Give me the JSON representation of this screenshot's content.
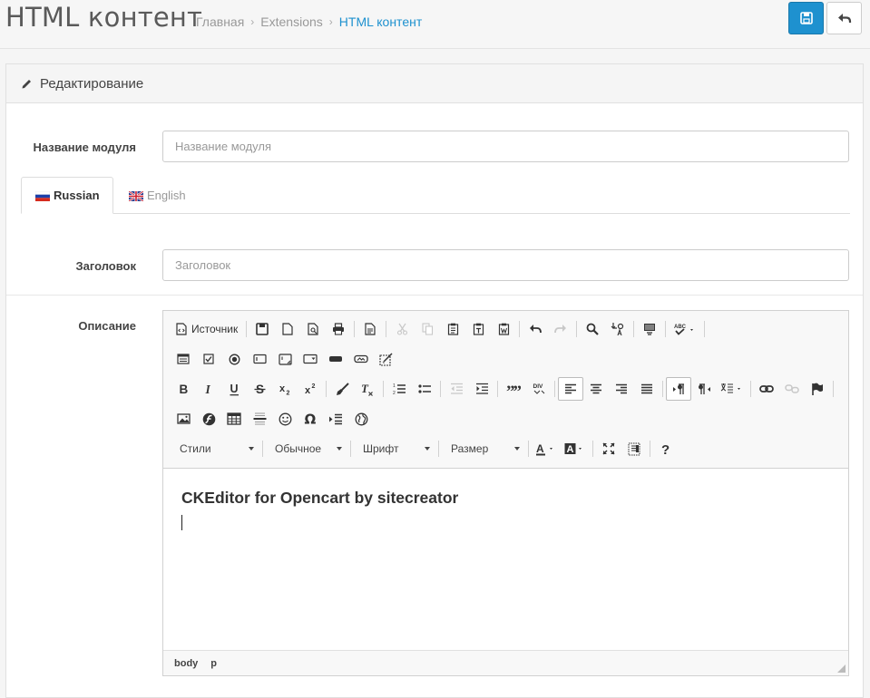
{
  "header": {
    "title": "HTML контент",
    "breadcrumb": [
      "Главная",
      "Extensions",
      "HTML контент"
    ],
    "save_icon": "floppy-disk-icon",
    "back_icon": "reply-arrow-icon",
    "accent_color": "#1e91cf"
  },
  "panel": {
    "heading": "Редактирование",
    "heading_icon": "pencil-icon"
  },
  "form": {
    "module_name_label": "Название модуля",
    "module_name_placeholder": "Название модуля",
    "module_name_value": "",
    "tabs": [
      {
        "label": "Russian",
        "flag": "russian-flag-icon",
        "active": true
      },
      {
        "label": "English",
        "flag": "uk-flag-icon",
        "active": false
      }
    ],
    "title_label": "Заголовок",
    "title_placeholder": "Заголовок",
    "title_value": "",
    "description_label": "Описание"
  },
  "editor": {
    "source_label": "Источник",
    "styles_label": "Стили",
    "format_label": "Обычное",
    "font_label": "Шрифт",
    "size_label": "Размер",
    "content_heading": "CKEditor for Opencart by sitecreator",
    "path": [
      "body",
      "p"
    ]
  }
}
